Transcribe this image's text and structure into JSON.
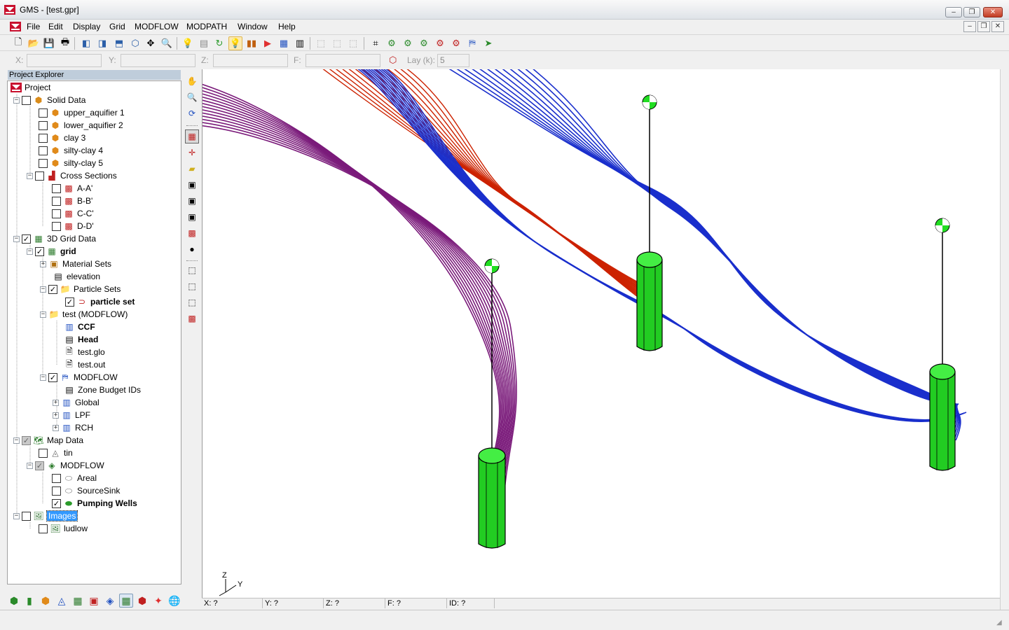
{
  "window": {
    "title": "GMS - [test.gpr]",
    "controls": {
      "minimize": "–",
      "restore": "❐",
      "close": "✕"
    }
  },
  "menu": {
    "items": [
      {
        "label": "File"
      },
      {
        "label": "Edit"
      },
      {
        "label": "Display"
      },
      {
        "label": "Grid"
      },
      {
        "label": "MODFLOW"
      },
      {
        "label": "MODPATH"
      },
      {
        "label": "Window"
      },
      {
        "label": "Help"
      }
    ]
  },
  "edit_bar": {
    "x_label": "X:",
    "y_label": "Y:",
    "z_label": "Z:",
    "f_label": "F:",
    "lay_label": "Lay (k):",
    "lay_value": "5"
  },
  "explorer": {
    "header": "Project Explorer",
    "nodes": {
      "project": "Project",
      "solid_data": "Solid Data",
      "upper_aquifier": "upper_aquifier 1",
      "lower_aquifier": "lower_aquifier 2",
      "clay": "clay 3",
      "silty_clay4": "silty-clay 4",
      "silty_clay5": "silty-clay 5",
      "cross_sections": "Cross Sections",
      "aa": "A-A'",
      "bb": "B-B'",
      "cc": "C-C'",
      "dd": "D-D'",
      "grid_data": "3D Grid Data",
      "grid": "grid",
      "material_sets": "Material Sets",
      "elevation": "elevation",
      "particle_sets": "Particle Sets",
      "particle_set": "particle set",
      "test_modflow": "test (MODFLOW)",
      "ccf": "CCF",
      "head": "Head",
      "test_glo": "test.glo",
      "test_out": "test.out",
      "modflow": "MODFLOW",
      "zone_budget": "Zone Budget IDs",
      "global": "Global",
      "lpf": "LPF",
      "rch": "RCH",
      "map_data": "Map Data",
      "tin": "tin",
      "map_modflow": "MODFLOW",
      "areal": "Areal",
      "sourcesink": "SourceSink",
      "pumping_wells": "Pumping Wells",
      "images": "Images",
      "ludlow": "ludlow"
    }
  },
  "viewport": {
    "axis_labels": {
      "z": "Z",
      "y": "Y"
    },
    "colors": {
      "purple": "#7a1a7a",
      "red": "#cc2200",
      "blue": "#1a2fcc",
      "well": "#22cc22"
    }
  },
  "status": {
    "x": "X: ?",
    "y": "Y: ?",
    "z": "Z: ?",
    "f": "F: ?",
    "id": "ID: ?"
  }
}
